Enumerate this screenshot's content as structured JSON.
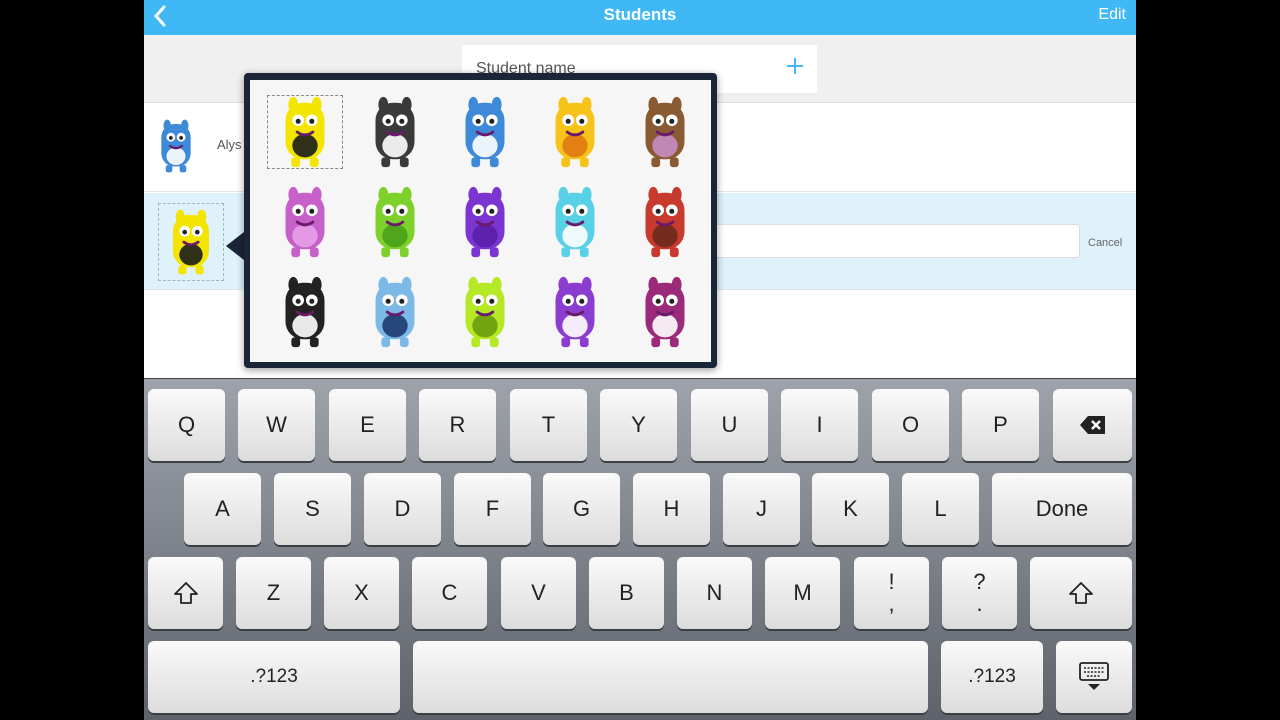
{
  "nav": {
    "title": "Students",
    "back_icon": "chevron-left-icon",
    "edit_label": "Edit"
  },
  "name_field": {
    "placeholder": "Student name",
    "add_icon": "plus-icon"
  },
  "students": [
    {
      "name_partial": "Alys",
      "avatar": "blue-monster"
    },
    {
      "avatar": "yellow-black-monster",
      "cancel_label": "Cancel"
    }
  ],
  "avatar_picker": {
    "selected_index": 0,
    "avatars": [
      {
        "name": "yellow-black-monster",
        "body": "#f4e500",
        "accent": "#1b1b1b"
      },
      {
        "name": "black-white-monster",
        "body": "#3a3a3a",
        "accent": "#ffffff"
      },
      {
        "name": "blue-monster",
        "body": "#3e8ad8",
        "accent": "#ffffff"
      },
      {
        "name": "yellow-orange-monster",
        "body": "#f6c31a",
        "accent": "#e07a12"
      },
      {
        "name": "brown-antler-monster",
        "body": "#8a5a33",
        "accent": "#c78cc4"
      },
      {
        "name": "pink-monster",
        "body": "#c760c9",
        "accent": "#e6a0e8"
      },
      {
        "name": "green-cyclops-monster",
        "body": "#7ed12b",
        "accent": "#4aa11a"
      },
      {
        "name": "purple-horned-monster",
        "body": "#7b36d1",
        "accent": "#5a1fa8"
      },
      {
        "name": "cyan-monster",
        "body": "#58d0e6",
        "accent": "#ffffff"
      },
      {
        "name": "red-spiky-monster",
        "body": "#c83a2e",
        "accent": "#6b2b1e"
      },
      {
        "name": "panda-monster",
        "body": "#222222",
        "accent": "#ffffff"
      },
      {
        "name": "light-blue-monster",
        "body": "#7db9e7",
        "accent": "#1e3a6d"
      },
      {
        "name": "lime-alien-monster",
        "body": "#b5e825",
        "accent": "#6a9b10"
      },
      {
        "name": "purple-monster",
        "body": "#8b3dd0",
        "accent": "#ffffff"
      },
      {
        "name": "magenta-monster",
        "body": "#9b2a7a",
        "accent": "#ffffff"
      }
    ]
  },
  "keyboard": {
    "row1": [
      "Q",
      "W",
      "E",
      "R",
      "T",
      "Y",
      "U",
      "I",
      "O",
      "P"
    ],
    "row2": [
      "A",
      "S",
      "D",
      "F",
      "G",
      "H",
      "J",
      "K",
      "L"
    ],
    "row3": [
      "Z",
      "X",
      "C",
      "V",
      "B",
      "N",
      "M"
    ],
    "punct1": [
      "!",
      ","
    ],
    "punct2": [
      "?",
      "."
    ],
    "backspace_icon": "backspace-icon",
    "done_label": "Done",
    "shift_icon": "shift-icon",
    "numbers_label": ".?123",
    "hide_keyboard_icon": "keyboard-hide-icon"
  },
  "colors": {
    "nav": "#3fb8f5",
    "selected_row": "#dff1fb",
    "keyboard": "#80858c"
  }
}
